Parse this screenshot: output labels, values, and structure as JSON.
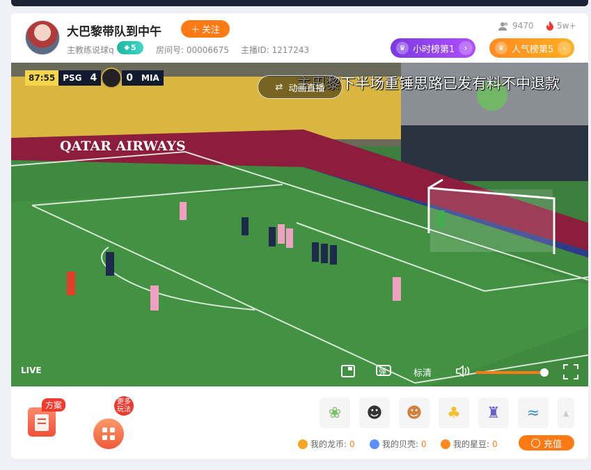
{
  "header": {
    "title": "大巴黎带队到中午",
    "follow_label": "关注",
    "category": "主教练说球q",
    "level": "5",
    "room_label": "房间号:",
    "room_id": "00006675",
    "host_label": "主播ID:",
    "host_id": "1217243",
    "viewers": "9470",
    "heat": "5w+",
    "rank_hour": "小时榜第1",
    "rank_pop": "人气榜第5"
  },
  "video": {
    "score_time": "87:55",
    "team_home": "PSG",
    "score_home": "4",
    "score_away": "0",
    "team_away": "MIA",
    "anim_label": "动画直播",
    "danmu": "主巴黎下半场重锤思路已发有料不中退款",
    "board_text": "QATAR AIRWAYS",
    "live_label": "LIVE",
    "quality_label": "标清",
    "danmu_icon": "弹",
    "volume": 0.95
  },
  "bottom": {
    "plan_label": "方案",
    "more_label": "更多玩法",
    "wallet": [
      {
        "label": "我的龙币:",
        "value": "0",
        "color": "#f5a623"
      },
      {
        "label": "我的贝壳:",
        "value": "0",
        "color": "#5b8ff9"
      },
      {
        "label": "我的星豆:",
        "value": "0",
        "color": "#ff8a1f"
      }
    ],
    "recharge_label": "充值"
  },
  "colors": {
    "accent": "#ff7a15",
    "rank_hour": "#8a3ff0",
    "rank_pop": "#ffa020"
  }
}
